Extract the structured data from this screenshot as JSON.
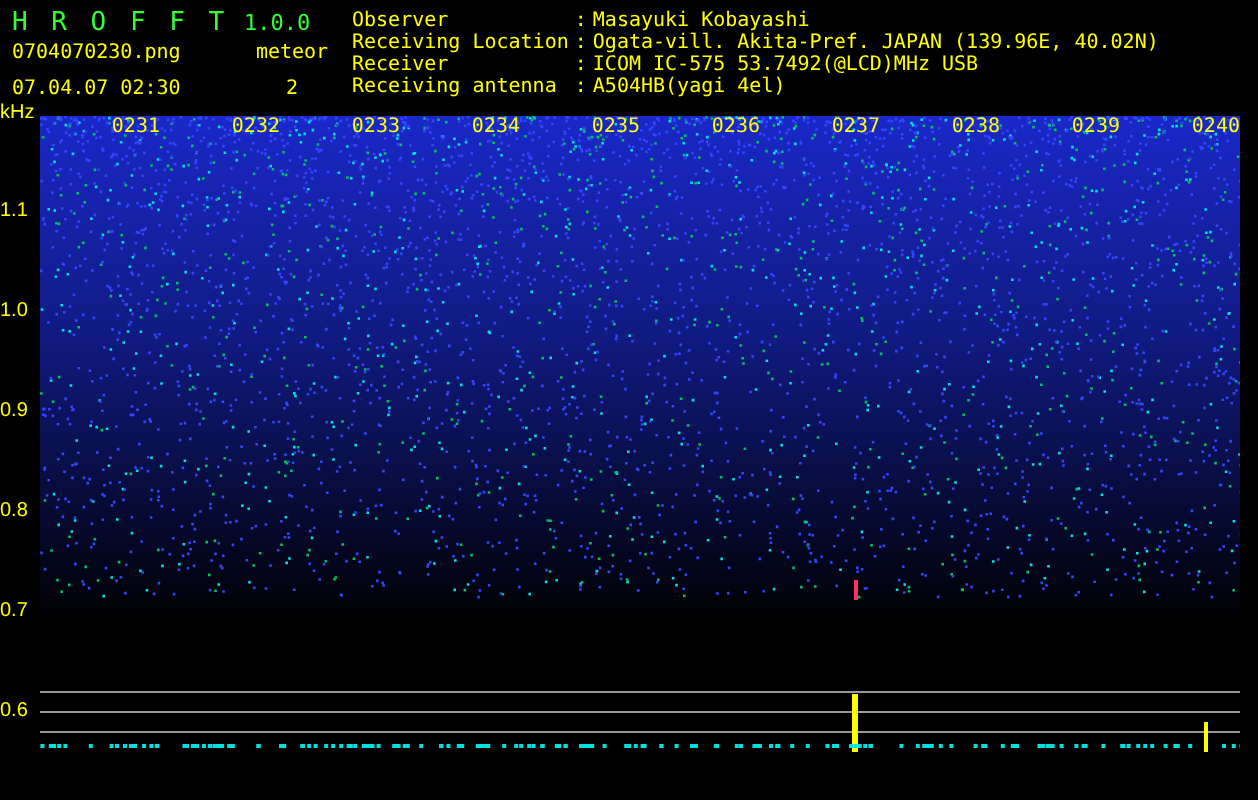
{
  "app": {
    "name": "H R O F F T",
    "version": "1.0.0"
  },
  "file": {
    "name": "0704070230.png",
    "datetime": "07.04.07 02:30"
  },
  "meteor": {
    "label": "meteor",
    "count": "2"
  },
  "info": [
    {
      "label": "Observer",
      "sep": ":",
      "value": "Masayuki Kobayashi"
    },
    {
      "label": "Receiving Location",
      "sep": ":",
      "value": "Ogata-vill. Akita-Pref. JAPAN (139.96E, 40.02N)"
    },
    {
      "label": "Receiver",
      "sep": ":",
      "value": "ICOM IC-575 53.7492(@LCD)MHz USB"
    },
    {
      "label": "Receiving antenna",
      "sep": ":",
      "value": "A504HB(yagi 4el)"
    }
  ],
  "y_axis": {
    "unit": "kHz",
    "labels": [
      "1.1",
      "1.0",
      "0.9",
      "0.8",
      "0.7",
      "0.6"
    ]
  },
  "time_labels": [
    "0231",
    "0232",
    "0233",
    "0234",
    "0235",
    "0236",
    "0237",
    "0238",
    "0239",
    "0240"
  ]
}
